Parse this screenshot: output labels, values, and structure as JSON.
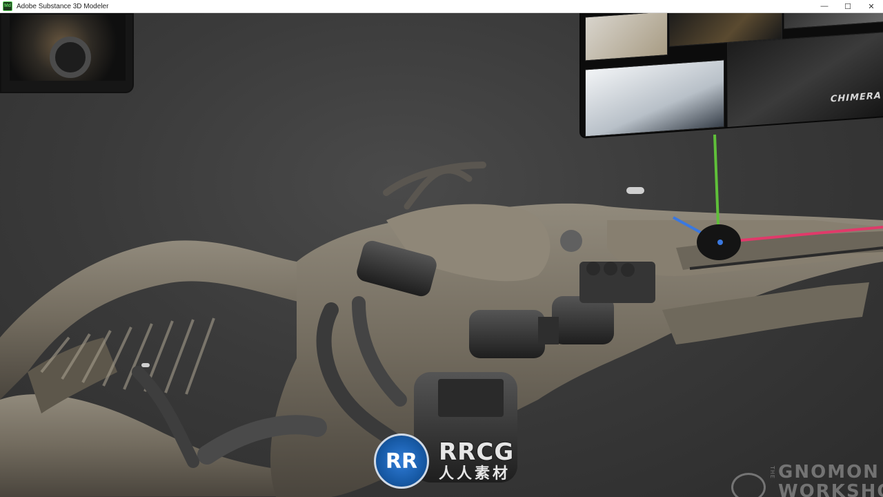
{
  "window": {
    "title": "Adobe Substance 3D Modeler",
    "app_icon": "Md",
    "controls": {
      "minimize": "—",
      "maximize": "☐",
      "close": "✕"
    }
  },
  "reference_right": {
    "caption": "CHIMERA"
  },
  "watermarks": {
    "rrcg": {
      "logo": "RR",
      "brand": "RRCG",
      "sub": "人人素材"
    },
    "gnomon": {
      "the": "THE",
      "line1": "GNOMON",
      "line2": "WORKSHOP"
    }
  },
  "colors": {
    "gizmo_y": "#5fbf3a",
    "gizmo_x": "#e03a6a",
    "gizmo_z": "#3a78e0",
    "model_base": "#7a7264"
  }
}
